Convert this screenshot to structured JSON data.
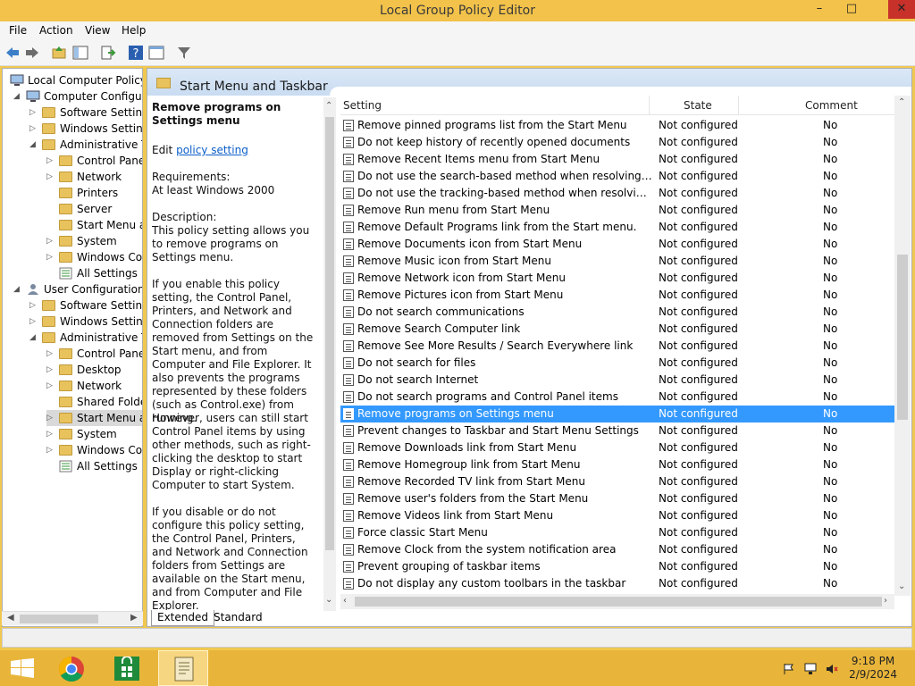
{
  "window": {
    "title": "Local Group Policy Editor",
    "controls": {
      "minimize": "–",
      "maximize": "□",
      "close": "✕"
    }
  },
  "menu": [
    "File",
    "Action",
    "View",
    "Help"
  ],
  "tree": {
    "items": [
      {
        "label": "Local Computer Policy",
        "expander": ""
      },
      {
        "label": "Computer Configura",
        "expander": "◢"
      },
      {
        "label": "Software Settings",
        "expander": "▷"
      },
      {
        "label": "Windows Setting",
        "expander": "▷"
      },
      {
        "label": "Administrative Te",
        "expander": "◢"
      },
      {
        "label": "Control Panel",
        "expander": "▷"
      },
      {
        "label": "Network",
        "expander": "▷"
      },
      {
        "label": "Printers",
        "expander": ""
      },
      {
        "label": "Server",
        "expander": ""
      },
      {
        "label": "Start Menu ar",
        "expander": ""
      },
      {
        "label": "System",
        "expander": "▷"
      },
      {
        "label": "Windows Cor",
        "expander": "▷"
      },
      {
        "label": "All Settings",
        "expander": ""
      },
      {
        "label": "User Configuration",
        "expander": "◢"
      },
      {
        "label": "Software Settings",
        "expander": "▷"
      },
      {
        "label": "Windows Setting",
        "expander": "▷"
      },
      {
        "label": "Administrative Te",
        "expander": "◢"
      },
      {
        "label": "Control Panel",
        "expander": "▷"
      },
      {
        "label": "Desktop",
        "expander": "▷"
      },
      {
        "label": "Network",
        "expander": "▷"
      },
      {
        "label": "Shared Folder",
        "expander": ""
      },
      {
        "label": "Start Menu ar",
        "expander": "▷"
      },
      {
        "label": "System",
        "expander": "▷"
      },
      {
        "label": "Windows Cor",
        "expander": "▷"
      },
      {
        "label": "All Settings",
        "expander": ""
      }
    ]
  },
  "panel": {
    "title": "Start Menu and Taskbar"
  },
  "description": {
    "heading": "Remove programs on Settings menu",
    "edit_prefix": "Edit",
    "edit_link": "policy setting",
    "requirements_label": "Requirements:",
    "requirements_value": "At least Windows 2000",
    "description_label": "Description:",
    "p1": "This policy setting allows you to remove programs on Settings menu.",
    "p2": "If you enable this policy setting, the Control Panel, Printers, and Network and Connection folders are removed from Settings on the Start menu, and from Computer and File Explorer. It also prevents the programs represented by these folders (such as Control.exe) from running.",
    "p3": "However, users can still start Control Panel items by using other methods, such as right-clicking the desktop to start Display or right-clicking Computer to start System.",
    "p4": "If you disable or do not configure this policy setting, the Control Panel, Printers, and Network and Connection folders from Settings are available on the Start menu, and from Computer and File Explorer."
  },
  "columns": {
    "setting": "Setting",
    "state": "State",
    "comment": "Comment"
  },
  "rows": [
    {
      "setting": "Remove pinned programs list from the Start Menu",
      "state": "Not configured",
      "comment": "No"
    },
    {
      "setting": "Do not keep history of recently opened documents",
      "state": "Not configured",
      "comment": "No"
    },
    {
      "setting": "Remove Recent Items menu from Start Menu",
      "state": "Not configured",
      "comment": "No"
    },
    {
      "setting": "Do not use the search-based method when resolving shell s...",
      "state": "Not configured",
      "comment": "No"
    },
    {
      "setting": "Do not use the tracking-based method when resolving shell ...",
      "state": "Not configured",
      "comment": "No"
    },
    {
      "setting": "Remove Run menu from Start Menu",
      "state": "Not configured",
      "comment": "No"
    },
    {
      "setting": "Remove Default Programs link from the Start menu.",
      "state": "Not configured",
      "comment": "No"
    },
    {
      "setting": "Remove Documents icon from Start Menu",
      "state": "Not configured",
      "comment": "No"
    },
    {
      "setting": "Remove Music icon from Start Menu",
      "state": "Not configured",
      "comment": "No"
    },
    {
      "setting": "Remove Network icon from Start Menu",
      "state": "Not configured",
      "comment": "No"
    },
    {
      "setting": "Remove Pictures icon from Start Menu",
      "state": "Not configured",
      "comment": "No"
    },
    {
      "setting": "Do not search communications",
      "state": "Not configured",
      "comment": "No"
    },
    {
      "setting": "Remove Search Computer link",
      "state": "Not configured",
      "comment": "No"
    },
    {
      "setting": "Remove See More Results / Search Everywhere link",
      "state": "Not configured",
      "comment": "No"
    },
    {
      "setting": "Do not search for files",
      "state": "Not configured",
      "comment": "No"
    },
    {
      "setting": "Do not search Internet",
      "state": "Not configured",
      "comment": "No"
    },
    {
      "setting": "Do not search programs and Control Panel items",
      "state": "Not configured",
      "comment": "No"
    },
    {
      "setting": "Remove programs on Settings menu",
      "state": "Not configured",
      "comment": "No"
    },
    {
      "setting": "Prevent changes to Taskbar and Start Menu Settings",
      "state": "Not configured",
      "comment": "No"
    },
    {
      "setting": "Remove Downloads link from Start Menu",
      "state": "Not configured",
      "comment": "No"
    },
    {
      "setting": "Remove Homegroup link from Start Menu",
      "state": "Not configured",
      "comment": "No"
    },
    {
      "setting": "Remove Recorded TV link from Start Menu",
      "state": "Not configured",
      "comment": "No"
    },
    {
      "setting": "Remove user's folders from the Start Menu",
      "state": "Not configured",
      "comment": "No"
    },
    {
      "setting": "Remove Videos link from Start Menu",
      "state": "Not configured",
      "comment": "No"
    },
    {
      "setting": "Force classic Start Menu",
      "state": "Not configured",
      "comment": "No"
    },
    {
      "setting": "Remove Clock from the system notification area",
      "state": "Not configured",
      "comment": "No"
    },
    {
      "setting": "Prevent grouping of taskbar items",
      "state": "Not configured",
      "comment": "No"
    },
    {
      "setting": "Do not display any custom toolbars in the taskbar",
      "state": "Not configured",
      "comment": "No"
    }
  ],
  "selected_row_index": 17,
  "tabs": {
    "extended": "Extended",
    "standard": "Standard"
  },
  "taskbar": {
    "time": "9:18 PM",
    "date": "2/9/2024"
  },
  "colors": {
    "titlebar": "#f2c24a",
    "selection": "#3399ff",
    "taskbar": "#e8b53a",
    "close": "#c7312a"
  }
}
